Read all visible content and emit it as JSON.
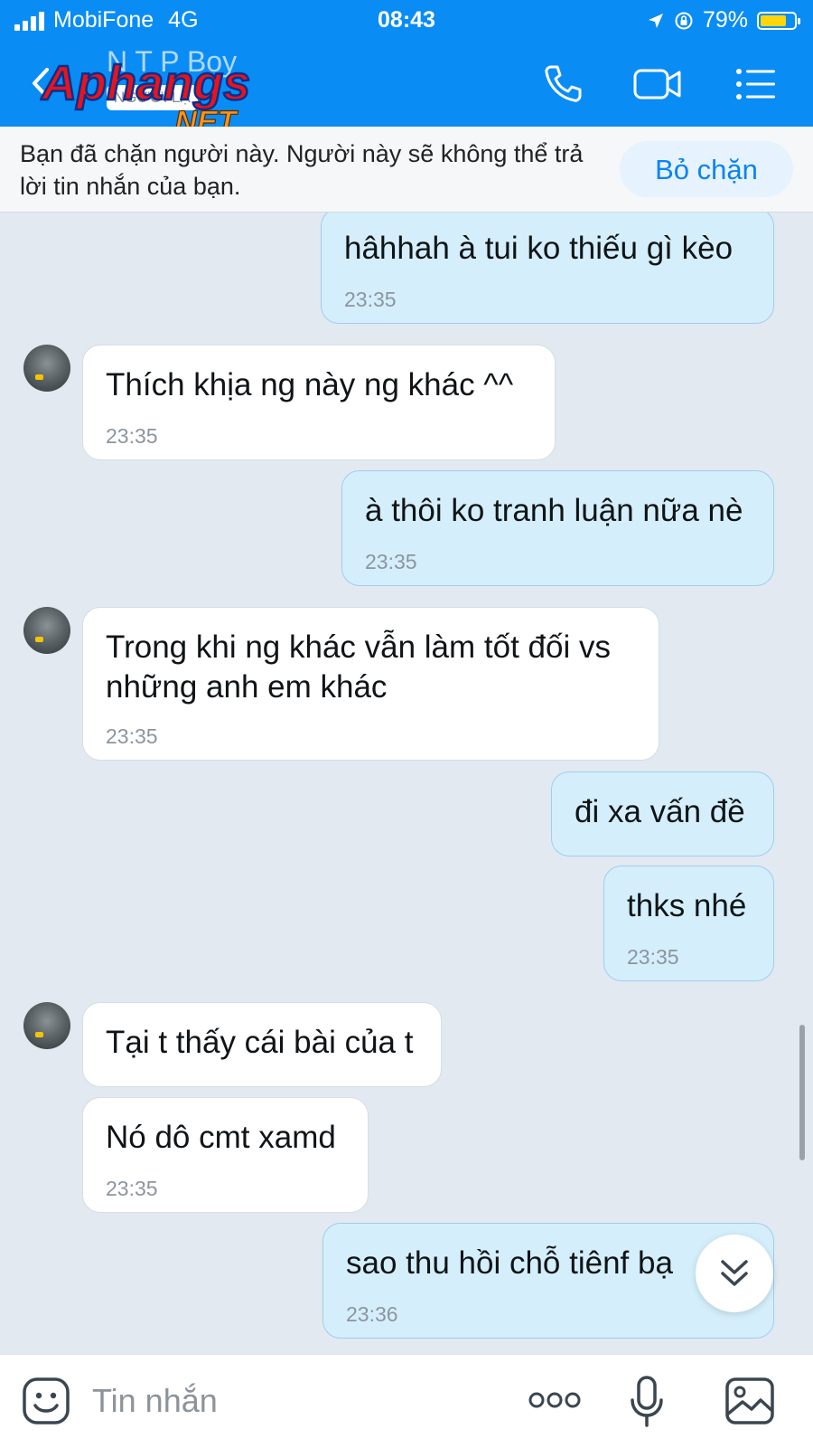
{
  "status_bar": {
    "carrier": "MobiFone",
    "network": "4G",
    "time": "08:43",
    "battery": "79%",
    "battery_level": 0.79
  },
  "header": {
    "contact_name": "N T P Boy",
    "stranger_badge": "NGƯỜI LẠ",
    "watermark_text": "Aphangs.NET",
    "icons": [
      "back-icon",
      "phone-icon",
      "video-call-icon",
      "menu-icon"
    ]
  },
  "block_notice": {
    "text": "Bạn đã chặn người này. Người này sẽ không thể trả lời tin nhắn của bạn.",
    "button": "Bỏ chặn"
  },
  "messages": [
    {
      "direction": "out",
      "text": "hâhhah à tui ko thiếu gì kèo",
      "time": "23:35"
    },
    {
      "direction": "in",
      "text": "Thích khịa ng này ng khác ^^",
      "time": "23:35"
    },
    {
      "direction": "out",
      "text": "à thôi ko tranh luận nữa nè",
      "time": "23:35"
    },
    {
      "direction": "in",
      "text": "Trong khi ng khác vẫn làm tốt đối vs những anh em khác",
      "time": "23:35"
    },
    {
      "direction": "out",
      "text": "đi xa vấn đề",
      "time": ""
    },
    {
      "direction": "out",
      "text": "thks nhé",
      "time": "23:35"
    },
    {
      "direction": "in",
      "text": "Tại t thấy cái bài của t",
      "time": ""
    },
    {
      "direction": "in",
      "text": "Nó dô cmt xamd",
      "time": "23:35"
    },
    {
      "direction": "out",
      "text": "sao thu hồi chỗ tiênf bạ",
      "time": "23:36"
    }
  ],
  "input_bar": {
    "placeholder": "Tin nhắn",
    "icons": [
      "emoji-icon",
      "more-icon",
      "microphone-icon",
      "image-icon"
    ]
  },
  "colors": {
    "header_blue": "#0a8cf5",
    "outgoing_bubble": "#d4effb",
    "incoming_bubble": "#ffffff",
    "chat_background": "#e2e9f1",
    "unblock_text": "#0a84f0"
  }
}
